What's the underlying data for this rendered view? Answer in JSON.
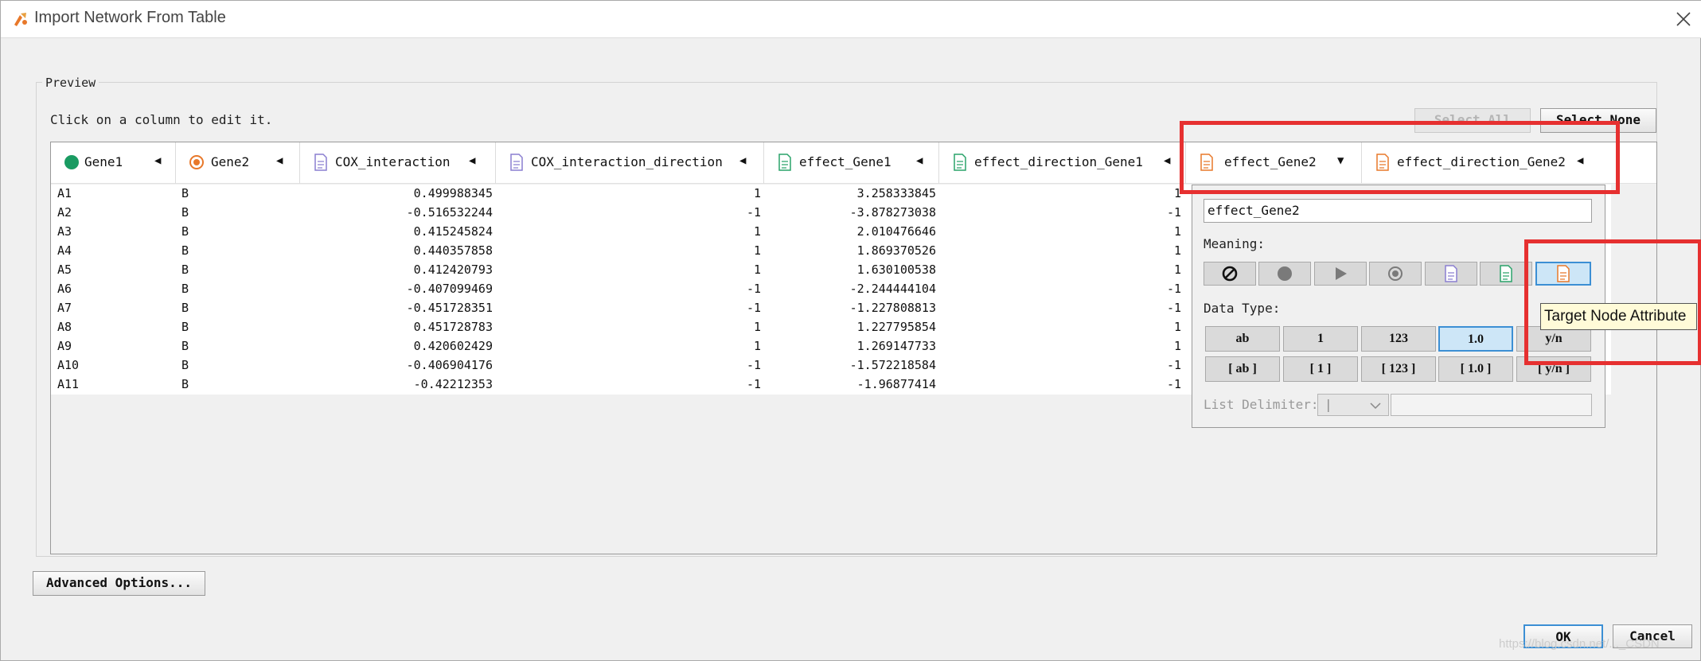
{
  "window": {
    "title": "Import Network From Table"
  },
  "preview": {
    "label": "Preview",
    "hint": "Click on a column to edit it.",
    "select_all_label": "Select All",
    "select_none_label": "Select None"
  },
  "columns": [
    {
      "name": "Gene1",
      "icon": "source-node-icon"
    },
    {
      "name": "Gene2",
      "icon": "target-node-icon"
    },
    {
      "name": "COX_interaction",
      "icon": "edge-attribute-icon"
    },
    {
      "name": "COX_interaction_direction",
      "icon": "edge-attribute-icon"
    },
    {
      "name": "effect_Gene1",
      "icon": "source-node-attribute-icon"
    },
    {
      "name": "effect_direction_Gene1",
      "icon": "source-node-attribute-icon"
    },
    {
      "name": "effect_Gene2",
      "icon": "target-node-attribute-icon"
    },
    {
      "name": "effect_direction_Gene2",
      "icon": "target-node-attribute-icon"
    }
  ],
  "rows": [
    [
      "A1",
      "B",
      "0.499988345",
      "1",
      "3.258333845",
      "1"
    ],
    [
      "A2",
      "B",
      "-0.516532244",
      "-1",
      "-3.878273038",
      "-1"
    ],
    [
      "A3",
      "B",
      "0.415245824",
      "1",
      "2.010476646",
      "1"
    ],
    [
      "A4",
      "B",
      "0.440357858",
      "1",
      "1.869370526",
      "1"
    ],
    [
      "A5",
      "B",
      "0.412420793",
      "1",
      "1.630100538",
      "1"
    ],
    [
      "A6",
      "B",
      "-0.407099469",
      "-1",
      "-2.244444104",
      "-1"
    ],
    [
      "A7",
      "B",
      "-0.451728351",
      "-1",
      "-1.227808813",
      "-1"
    ],
    [
      "A8",
      "B",
      "0.451728783",
      "1",
      "1.227795854",
      "1"
    ],
    [
      "A9",
      "B",
      "0.420602429",
      "1",
      "1.269147733",
      "1"
    ],
    [
      "A10",
      "B",
      "-0.406904176",
      "-1",
      "-1.572218584",
      "-1"
    ],
    [
      "A11",
      "B",
      "-0.42212353",
      "-1",
      "-1.96877414",
      "-1"
    ]
  ],
  "editor": {
    "column_name": "effect_Gene2",
    "meaning_label": "Meaning:",
    "data_type_label": "Data Type:",
    "list_delimiter_label": "List Delimiter:",
    "list_delimiter_value": "|",
    "meaning_buttons": [
      "not-imported-icon",
      "source-node-icon",
      "interaction-type-icon",
      "target-node-icon",
      "edge-attribute-icon",
      "source-node-attribute-icon",
      "target-node-attribute-icon"
    ],
    "data_types": [
      "ab",
      "1",
      "123",
      "1.0",
      "y/n",
      "[ ab ]",
      "[ 1 ]",
      "[ 123 ]",
      "[ 1.0 ]",
      "[ y/n ]"
    ],
    "selected_data_type": "1.0",
    "tooltip": "Target Node Attribute"
  },
  "buttons": {
    "advanced": "Advanced Options...",
    "ok": "OK",
    "cancel": "Cancel"
  },
  "watermark": "https://blog.csdn.net/..._CSDN",
  "colors": {
    "source_green": "#1a9b62",
    "target_orange": "#e8782a",
    "edge_purple": "#8a7fd0",
    "src_attr_green": "#2aa36a",
    "tgt_attr_orange": "#e8782a",
    "highlight_red": "#e63030"
  }
}
